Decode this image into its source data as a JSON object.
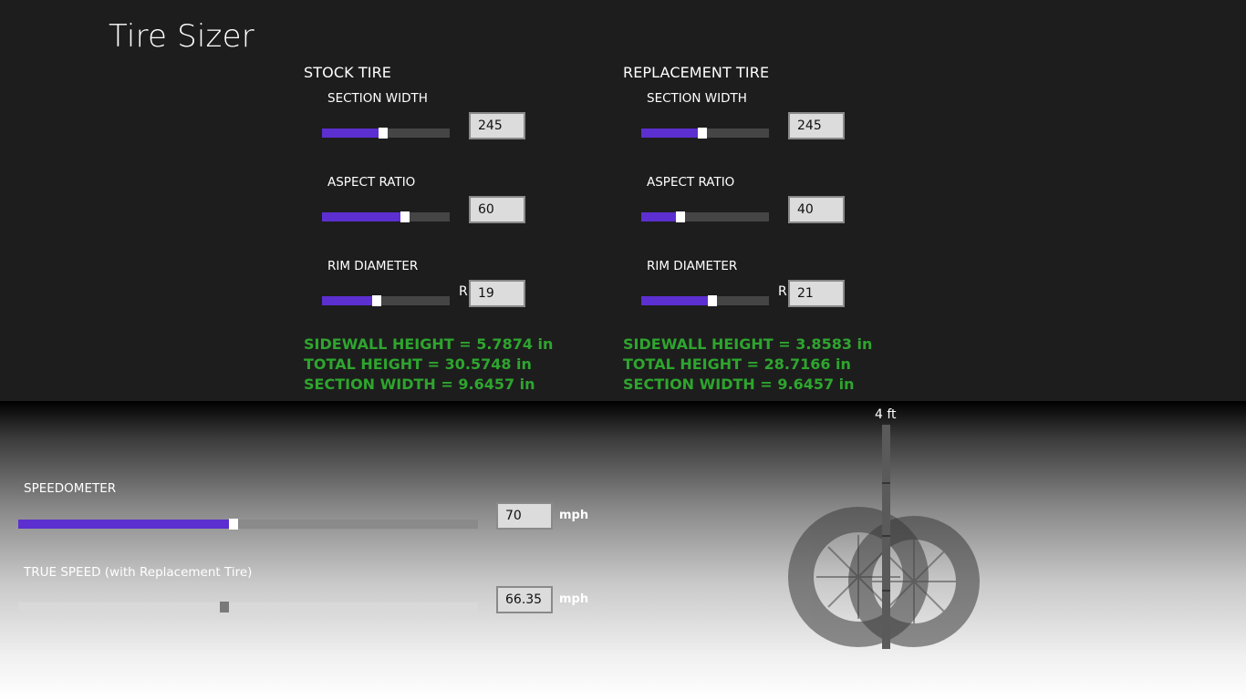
{
  "app": {
    "title": "Tire Sizer"
  },
  "stock": {
    "title": "STOCK TIRE",
    "section_width": {
      "label": "SECTION WIDTH",
      "value": "245",
      "slider_fraction": 0.45
    },
    "aspect_ratio": {
      "label": "ASPECT RATIO",
      "value": "60",
      "slider_fraction": 0.62
    },
    "rim_diameter": {
      "label": "RIM DIAMETER",
      "prefix": "R",
      "value": "19",
      "slider_fraction": 0.4
    },
    "results": {
      "sidewall": "SIDEWALL HEIGHT = 5.7874 in",
      "total": "TOTAL HEIGHT = 30.5748 in",
      "width": "SECTION WIDTH = 9.6457 in"
    }
  },
  "replacement": {
    "title": "REPLACEMENT TIRE",
    "section_width": {
      "label": "SECTION WIDTH",
      "value": "245",
      "slider_fraction": 0.45
    },
    "aspect_ratio": {
      "label": "ASPECT RATIO",
      "value": "40",
      "slider_fraction": 0.28
    },
    "rim_diameter": {
      "label": "RIM DIAMETER",
      "prefix": "R",
      "value": "21",
      "slider_fraction": 0.53
    },
    "results": {
      "sidewall": "SIDEWALL HEIGHT = 3.8583 in",
      "total": "TOTAL HEIGHT = 28.7166 in",
      "width": "SECTION WIDTH = 9.6457 in"
    }
  },
  "speedometer": {
    "label": "SPEEDOMETER",
    "value": "70",
    "unit": "mph",
    "slider_fraction": 0.46
  },
  "true_speed": {
    "label": "TRUE SPEED (with Replacement Tire)",
    "value": "66.35",
    "unit": "mph",
    "slider_fraction": 0.44
  },
  "visual": {
    "scale_label": "4 ft"
  },
  "colors": {
    "accent": "#5c2fd0",
    "result_green": "#2ea52e",
    "background": "#1d1d1d"
  }
}
